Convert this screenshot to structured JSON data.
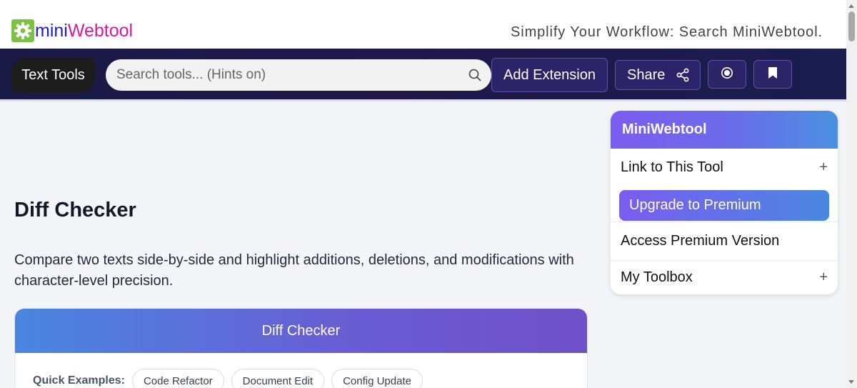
{
  "header": {
    "logo_part1": "mini",
    "logo_part2": "Webtool",
    "tagline": "Simplify Your Workflow: Search MiniWebtool."
  },
  "navbar": {
    "category_label": "Text Tools",
    "search_placeholder": "Search tools... (Hints on)",
    "add_extension_label": "Add Extension",
    "share_label": "Share",
    "icons": [
      "search-icon",
      "share-icon",
      "record-icon",
      "bookmark-icon"
    ]
  },
  "main": {
    "title": "Diff Checker",
    "description": "Compare two texts side-by-side and highlight additions, deletions, and modifications with character-level precision.",
    "card_title": "Diff Checker",
    "quick_examples_label": "Quick Examples:",
    "quick_examples": [
      "Code Refactor",
      "Document Edit",
      "Config Update"
    ]
  },
  "sidebar": {
    "title": "MiniWebtool",
    "link_label": "Link to This Tool",
    "premium_button": "Upgrade to Premium",
    "access_premium": "Access Premium Version",
    "toolbox_label": "My Toolbox",
    "plus_symbol": "+"
  },
  "colors": {
    "logo_green": "#7cc242",
    "logo_blue": "#1b1bd6",
    "logo_magenta": "#d61a9f",
    "navbar_bg": "#1d1b4a",
    "accent_purple": "#7b5cf0",
    "accent_blue": "#4a88e0"
  }
}
